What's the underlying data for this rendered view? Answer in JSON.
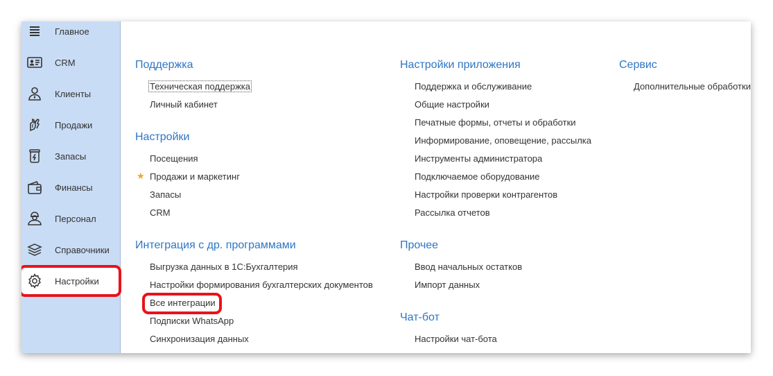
{
  "sidebar": {
    "items": [
      {
        "label": "Главное",
        "icon": "menu-icon"
      },
      {
        "label": "CRM",
        "icon": "contact-card-icon"
      },
      {
        "label": "Клиенты",
        "icon": "client-icon"
      },
      {
        "label": "Продажи",
        "icon": "sales-hand-icon"
      },
      {
        "label": "Запасы",
        "icon": "stock-jar-icon"
      },
      {
        "label": "Финансы",
        "icon": "wallet-icon"
      },
      {
        "label": "Персонал",
        "icon": "staff-icon"
      },
      {
        "label": "Справочники",
        "icon": "layers-icon"
      },
      {
        "label": "Настройки",
        "icon": "gear-icon"
      }
    ],
    "active_index": 8
  },
  "groups": {
    "support": {
      "title": "Поддержка",
      "items": [
        "Техническая поддержка",
        "Личный кабинет"
      ]
    },
    "settings": {
      "title": "Настройки",
      "items": [
        "Посещения",
        "Продажи и маркетинг",
        "Запасы",
        "CRM"
      ]
    },
    "integration": {
      "title": "Интеграция с др. программами",
      "items": [
        "Выгрузка данных в 1С:Бухгалтерия",
        "Настройки формирования бухгалтерских документов",
        "Все интеграции",
        "Подписки WhatsApp",
        "Синхронизация данных"
      ]
    },
    "app_settings": {
      "title": "Настройки приложения",
      "items": [
        "Поддержка и обслуживание",
        "Общие настройки",
        "Печатные формы, отчеты и обработки",
        "Информирование, оповещение, рассылка",
        "Инструменты администратора",
        "Подключаемое оборудование",
        "Настройки проверки контрагентов",
        "Рассылка отчетов"
      ]
    },
    "other": {
      "title": "Прочее",
      "items": [
        "Ввод начальных остатков",
        "Импорт данных"
      ]
    },
    "chatbot": {
      "title": "Чат-бот",
      "items": [
        "Настройки чат-бота"
      ]
    },
    "service": {
      "title": "Сервис",
      "items": [
        "Дополнительные обработки"
      ]
    }
  },
  "colors": {
    "sidebar_bg": "#c9dcf5",
    "group_title": "#2e76c4",
    "highlight": "#e8131b",
    "favorite_star": "#f0a528"
  }
}
